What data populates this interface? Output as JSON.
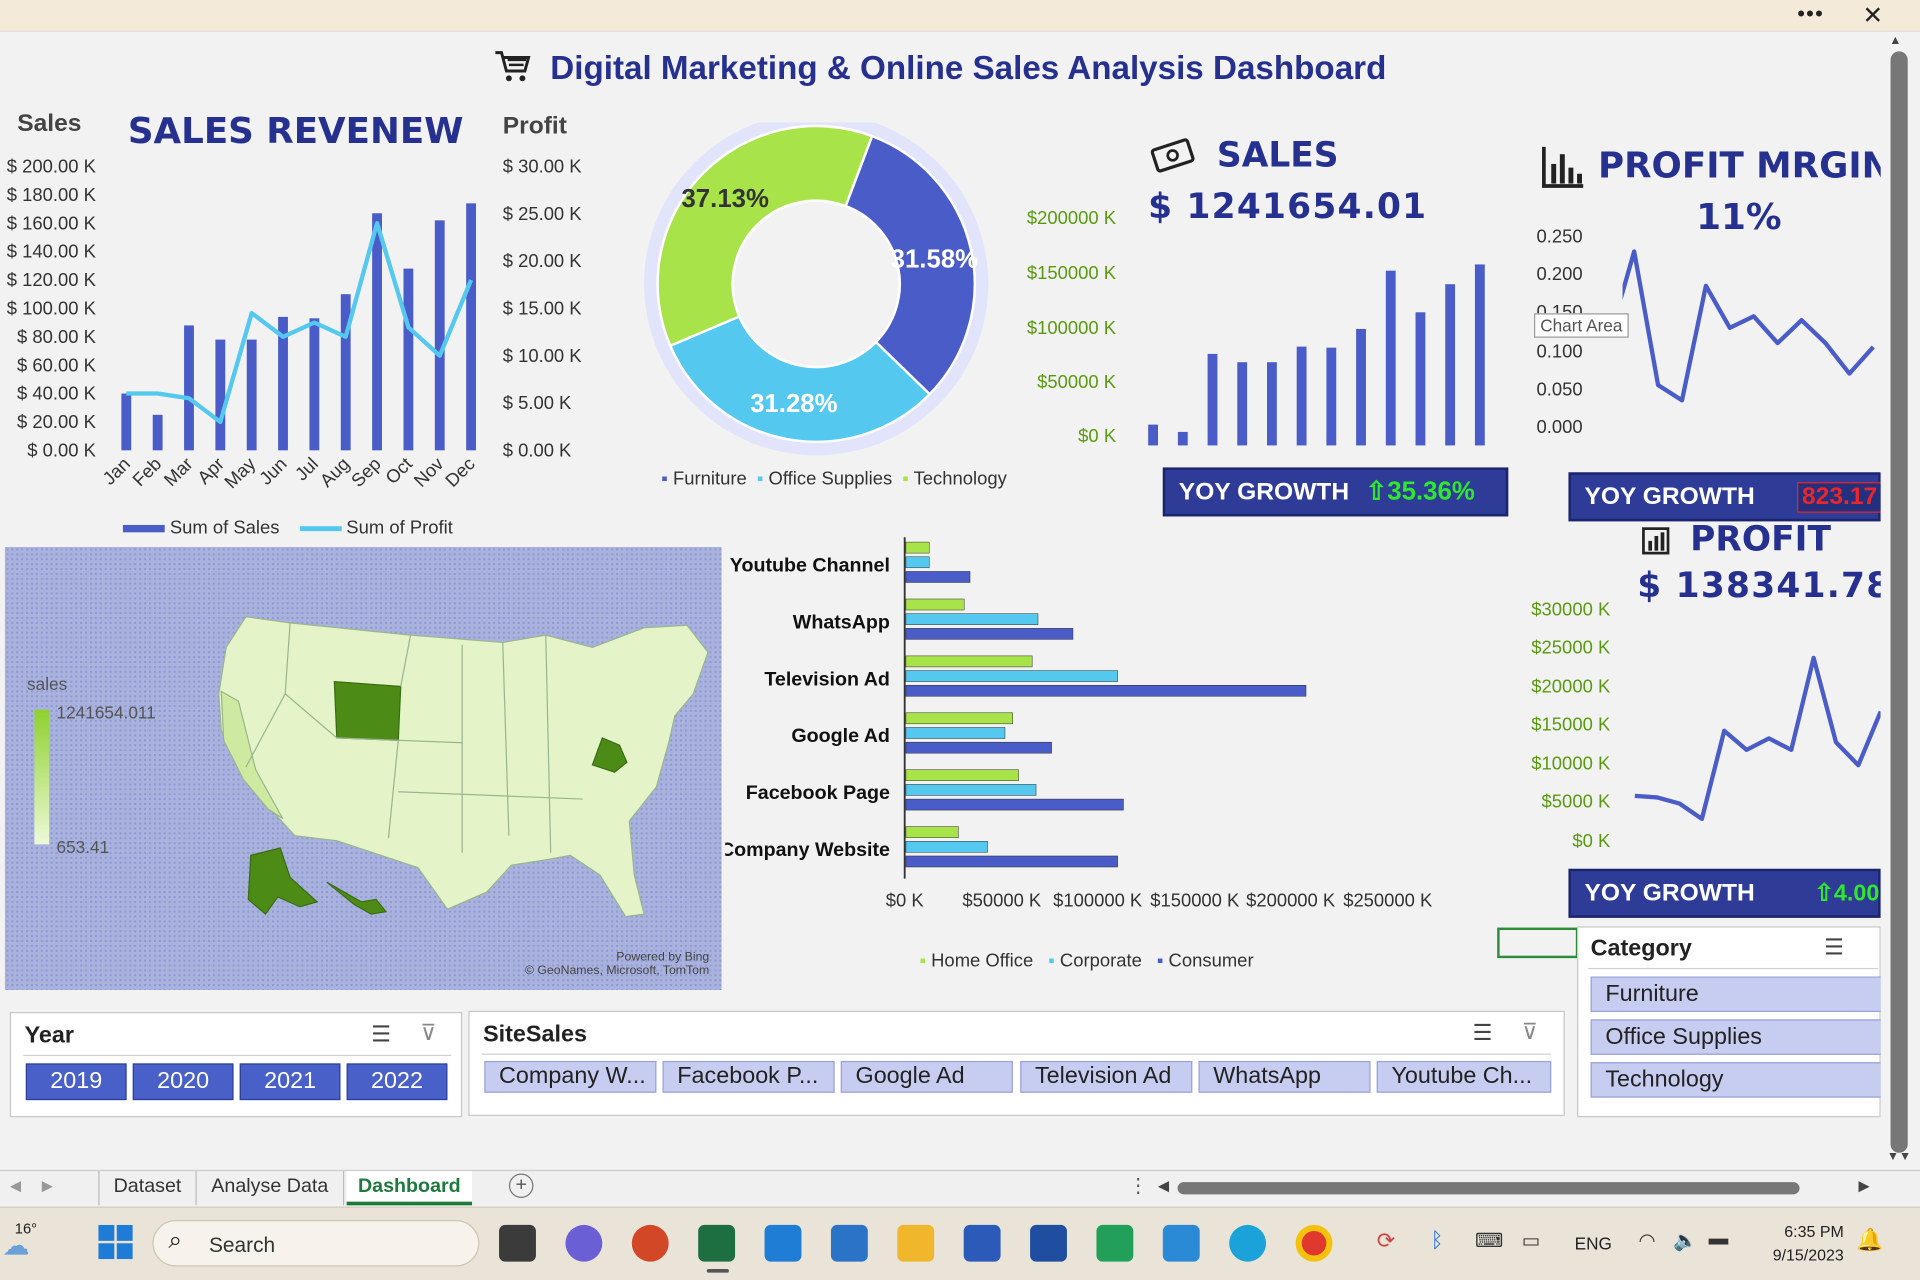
{
  "window": {
    "more_label": "•••",
    "close_label": "✕"
  },
  "title": "Digital Marketing & Online Sales Analysis Dashboard",
  "sales_revenue_chart": {
    "left_axis_title": "Sales",
    "heading": "SALES REVENEW",
    "right_axis_title": "Profit",
    "left_ticks": [
      "$ 200.00 K",
      "$ 180.00 K",
      "$ 160.00 K",
      "$ 140.00 K",
      "$ 120.00 K",
      "$ 100.00 K",
      "$ 80.00 K",
      "$ 60.00 K",
      "$ 40.00 K",
      "$ 20.00 K",
      "$ 0.00 K"
    ],
    "right_ticks": [
      "$ 30.00 K",
      "$ 25.00 K",
      "$ 20.00 K",
      "$ 15.00 K",
      "$ 10.00 K",
      "$ 5.00 K",
      "$ 0.00 K"
    ],
    "legend": [
      "Sum of Sales",
      "Sum of Profit"
    ]
  },
  "donut_legend": [
    "Furniture",
    "Office Supplies",
    "Technology"
  ],
  "sales_card": {
    "heading": "SALES",
    "value": "$ 1241654.01",
    "yoy_label": "YOY GROWTH",
    "yoy_value": "⇧35.36%",
    "ticks": [
      "$200000 K",
      "$150000 K",
      "$100000 K",
      "$50000 K",
      "$0 K"
    ]
  },
  "profit_margin_card": {
    "heading": "PROFIT MRGIN",
    "value": "11%",
    "yoy_label": "YOY GROWTH",
    "yoy_value": "823.17",
    "ticks": [
      "0.250",
      "0.200",
      "0.150",
      "0.100",
      "0.050",
      "0.000"
    ],
    "tooltip": "Chart Area"
  },
  "profit_card": {
    "heading": "PROFIT",
    "value": "$ 138341.78",
    "yoy_label": "YOY GROWTH",
    "yoy_value": "⇧4.00",
    "ticks": [
      "$30000 K",
      "$25000 K",
      "$20000 K",
      "$15000 K",
      "$10000 K",
      "$5000 K",
      "$0 K"
    ]
  },
  "map": {
    "legend_title": "sales",
    "max_label": "1241654.011",
    "min_label": "653.41",
    "credit_1": "Powered by Bing",
    "credit_2": "© GeoNames, Microsoft, TomTom"
  },
  "slicers": {
    "year": {
      "title": "Year",
      "items": [
        "2019",
        "2020",
        "2021",
        "2022"
      ]
    },
    "site": {
      "title": "SiteSales",
      "items": [
        "Company W...",
        "Facebook P...",
        "Google Ad",
        "Television Ad",
        "WhatsApp",
        "Youtube Ch..."
      ]
    },
    "category": {
      "title": "Category",
      "items": [
        "Furniture",
        "Office Supplies",
        "Technology"
      ]
    }
  },
  "tabs": [
    "Dataset",
    "Analyse Data",
    "Dashboard"
  ],
  "active_tab": "Dashboard",
  "taskbar": {
    "weather": "16°",
    "search_placeholder": "Search",
    "lang": "ENG",
    "time": "6:35 PM",
    "date": "9/15/2023"
  },
  "colors": {
    "accent": "#26318f",
    "bar_blue": "#4a5cc7",
    "line_cyan": "#54c8ee",
    "green": "#a8e34a",
    "axis_green": "#5a9a10"
  },
  "chart_data": [
    {
      "type": "bar",
      "title": "SALES REVENEW",
      "categories": [
        "Jan",
        "Feb",
        "Mar",
        "Apr",
        "May",
        "Jun",
        "Jul",
        "Aug",
        "Sep",
        "Oct",
        "Nov",
        "Dec"
      ],
      "series": [
        {
          "name": "Sum of Sales",
          "values": [
            40,
            25,
            88,
            78,
            78,
            94,
            93,
            110,
            167,
            128,
            162,
            174
          ]
        },
        {
          "name": "Sum of Profit",
          "values": [
            6,
            6,
            5.5,
            3,
            14.5,
            12,
            13.5,
            12,
            24,
            13,
            10,
            18
          ]
        }
      ],
      "ylabel": "Sales",
      "ylim": [
        0,
        200
      ],
      "y2label": "Profit",
      "y2lim": [
        0,
        30
      ],
      "legend": "bottom"
    },
    {
      "type": "pie",
      "categories": [
        "Furniture",
        "Office Supplies",
        "Technology"
      ],
      "values": [
        31.58,
        31.28,
        37.13
      ],
      "legend": "bottom"
    },
    {
      "type": "bar",
      "title": "SALES",
      "values": [
        20000,
        13000,
        88000,
        80000,
        80000,
        95000,
        94000,
        112000,
        168000,
        128000,
        155000,
        174000
      ],
      "ylim": [
        0,
        200000
      ]
    },
    {
      "type": "line",
      "title": "PROFIT MRGIN",
      "values": [
        0.12,
        0.23,
        0.055,
        0.035,
        0.185,
        0.13,
        0.145,
        0.11,
        0.14,
        0.11,
        0.07,
        0.105
      ],
      "ylim": [
        0,
        0.25
      ]
    },
    {
      "type": "line",
      "title": "PROFIT",
      "values": [
        6000,
        5800,
        5000,
        3000,
        14500,
        12000,
        13500,
        12000,
        24000,
        13000,
        10000,
        17000
      ],
      "ylim": [
        0,
        30000
      ]
    },
    {
      "type": "bar",
      "categories": [
        "Youtube Channel",
        "WhatsApp",
        "Television Ad",
        "Google Ad",
        "Facebook Page",
        "Company Website"
      ],
      "series": [
        {
          "name": "Home Office",
          "values": [
            12000,
            30000,
            65000,
            55000,
            58000,
            27000
          ]
        },
        {
          "name": "Corporate",
          "values": [
            12000,
            68000,
            109000,
            51000,
            67000,
            42000
          ]
        },
        {
          "name": "Consumer",
          "values": [
            33000,
            86000,
            206000,
            75000,
            112000,
            109000
          ]
        }
      ],
      "xlim": [
        0,
        250000
      ],
      "xticks": [
        "$0 K",
        "$50000 K",
        "$100000 K",
        "$150000 K",
        "$200000 K",
        "$250000 K"
      ],
      "legend": "bottom"
    }
  ]
}
